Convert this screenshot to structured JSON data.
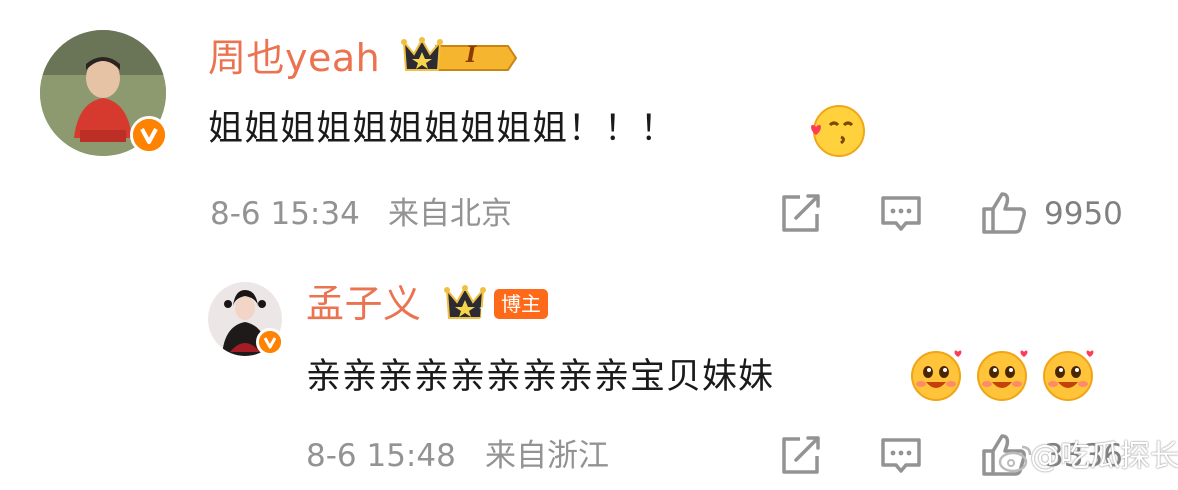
{
  "comment": {
    "user_name": "周也yeah",
    "member_level": "I",
    "text": "姐姐姐姐姐姐姐姐姐姐！！！",
    "emoji": "kiss-emoji",
    "time": "8-6 15:34",
    "location": "来自北京",
    "like_count": "9950"
  },
  "reply": {
    "user_name": "孟子义",
    "member_level": "I",
    "tag": "博主",
    "text": "亲亲亲亲亲亲亲亲亲宝贝妹妹",
    "emojis": [
      "shy-love-emoji",
      "shy-love-emoji",
      "shy-love-emoji"
    ],
    "time": "8-6 15:48",
    "location": "来自浙江",
    "like_count": "3336"
  },
  "watermark": "@吃瓜探长",
  "colors": {
    "name": "#eb7350",
    "meta": "#939393",
    "verified": "#ff8200",
    "tag": "#ff6a1a"
  }
}
